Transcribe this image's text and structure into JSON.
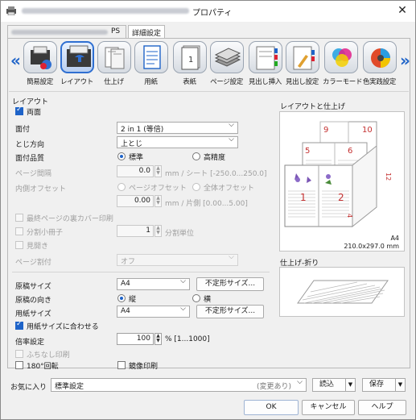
{
  "window": {
    "title": "プロパティ"
  },
  "tabs": [
    {
      "label": "PS"
    },
    {
      "label": "詳細設定"
    }
  ],
  "toolbar": {
    "items": [
      {
        "label": "簡易設定",
        "icon": "quick-setup-icon"
      },
      {
        "label": "レイアウト",
        "icon": "layout-icon"
      },
      {
        "label": "仕上げ",
        "icon": "finishing-icon"
      },
      {
        "label": "用紙",
        "icon": "paper-icon"
      },
      {
        "label": "表紙",
        "icon": "cover-icon"
      },
      {
        "label": "ページ設定",
        "icon": "page-setup-icon"
      },
      {
        "label": "見出し挿入",
        "icon": "tab-insert-icon"
      },
      {
        "label": "見出し設定",
        "icon": "tab-setting-icon"
      },
      {
        "label": "カラーモード",
        "icon": "color-mode-icon"
      },
      {
        "label": "色実践設定",
        "icon": "color-setting-icon"
      }
    ]
  },
  "layout": {
    "section_title": "レイアウト",
    "duplex_label": "両面",
    "nup_label": "面付",
    "nup_value": "2 in 1 (等倍)",
    "binding_label": "とじ方向",
    "binding_value": "上とじ",
    "quality_label": "面付品質",
    "quality_standard": "標準",
    "quality_high": "高精度",
    "gap_label": "ページ間隔",
    "gap_value": "0.0",
    "gap_unit": "mm / シート [-250.0...250.0]",
    "inner_offset_label": "内側オフセット",
    "page_offset": "ページオフセット",
    "whole_offset": "全体オフセット",
    "offset_value": "0.00",
    "offset_unit": "mm / 片側 [0.00...5.00]",
    "last_page_back_cover": "最終ページの裏カバー印刷",
    "split_booklet": "分割小冊子",
    "split_value": "1",
    "split_unit": "分割単位",
    "spread": "見開き",
    "page_split_label": "ページ割付",
    "page_split_value": "オフ"
  },
  "paper": {
    "original_size_label": "原稿サイズ",
    "original_size_value": "A4",
    "custom_size_button": "不定形サイズ...",
    "orientation_label": "原稿の向き",
    "orientation_portrait": "縦",
    "orientation_landscape": "横",
    "paper_size_label": "用紙サイズ",
    "paper_size_value": "A4",
    "fit_to_paper": "用紙サイズに合わせる",
    "zoom_label": "倍率設定",
    "zoom_value": "100",
    "zoom_unit": "% [1...1000]",
    "borderless": "ふちなし印刷",
    "rotate180": "180°回転",
    "mirror": "鏡像印刷"
  },
  "preview": {
    "layout_title": "レイアウトと仕上げ",
    "paper_name": "A4",
    "paper_dims": "210.0x297.0 mm",
    "page_numbers": [
      "1",
      "2",
      "4",
      "5",
      "6",
      "9",
      "10",
      "12"
    ],
    "finish_title": "仕上げ-折り"
  },
  "favorites": {
    "label": "お気に入り",
    "value": "標準設定",
    "changed": "(変更あり)",
    "load_button": "読込",
    "save_button": "保存"
  },
  "dialog_buttons": {
    "ok": "OK",
    "cancel": "キャンセル",
    "help": "ヘルプ"
  },
  "colors": {
    "accent": "#1e63c8",
    "page_number_red": "#c43030"
  }
}
